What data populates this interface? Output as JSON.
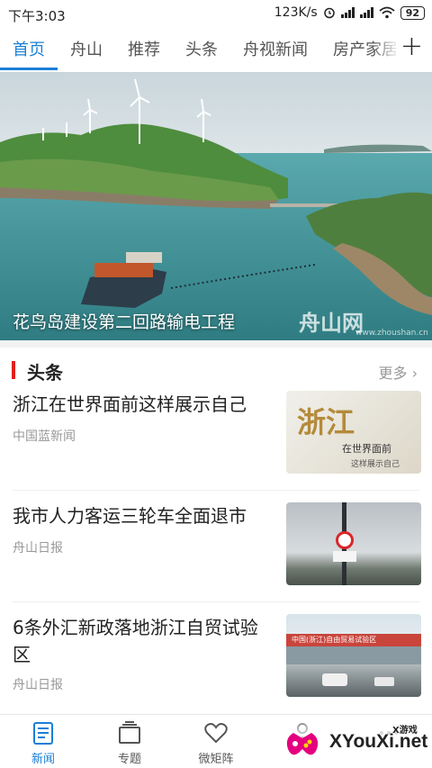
{
  "status": {
    "time": "下午3:03",
    "speed": "123K/s",
    "network": "4G",
    "battery": "92"
  },
  "tabs": [
    {
      "label": "首页",
      "active": true
    },
    {
      "label": "舟山"
    },
    {
      "label": "推荐"
    },
    {
      "label": "头条"
    },
    {
      "label": "舟视新闻"
    },
    {
      "label": "房产家居"
    }
  ],
  "hero": {
    "caption": "花鸟岛建设第二回路输电工程",
    "logo_text": "舟山网",
    "logo_url": "www.zhoushan.cn"
  },
  "section": {
    "title": "头条",
    "more": "更多"
  },
  "news": [
    {
      "title": "浙江在世界面前这样展示自己",
      "source": "中国蓝新闻",
      "thumb_main": "浙江",
      "thumb_sub": "在世界面前",
      "thumb_sub2": "这样展示自己"
    },
    {
      "title": "我市人力客运三轮车全面退市",
      "source": "舟山日报"
    },
    {
      "title": "6条外汇新政落地浙江自贸试验区",
      "source": "舟山日报",
      "thumb_sign": "中国(浙江)自由贸易试验区"
    }
  ],
  "bottom_nav": [
    {
      "label": "新闻",
      "icon": "news-doc-icon",
      "active": true
    },
    {
      "label": "专题",
      "icon": "topic-stack-icon"
    },
    {
      "label": "微矩阵",
      "icon": "heart-icon"
    },
    {
      "label": "",
      "icon": "user-icon"
    },
    {
      "label": "",
      "icon": "more-icon"
    }
  ],
  "watermark": {
    "text": "XYouXi.net",
    "small": "X游戏"
  },
  "colors": {
    "accent": "#1a7fd6",
    "section_bar": "#e02020"
  }
}
